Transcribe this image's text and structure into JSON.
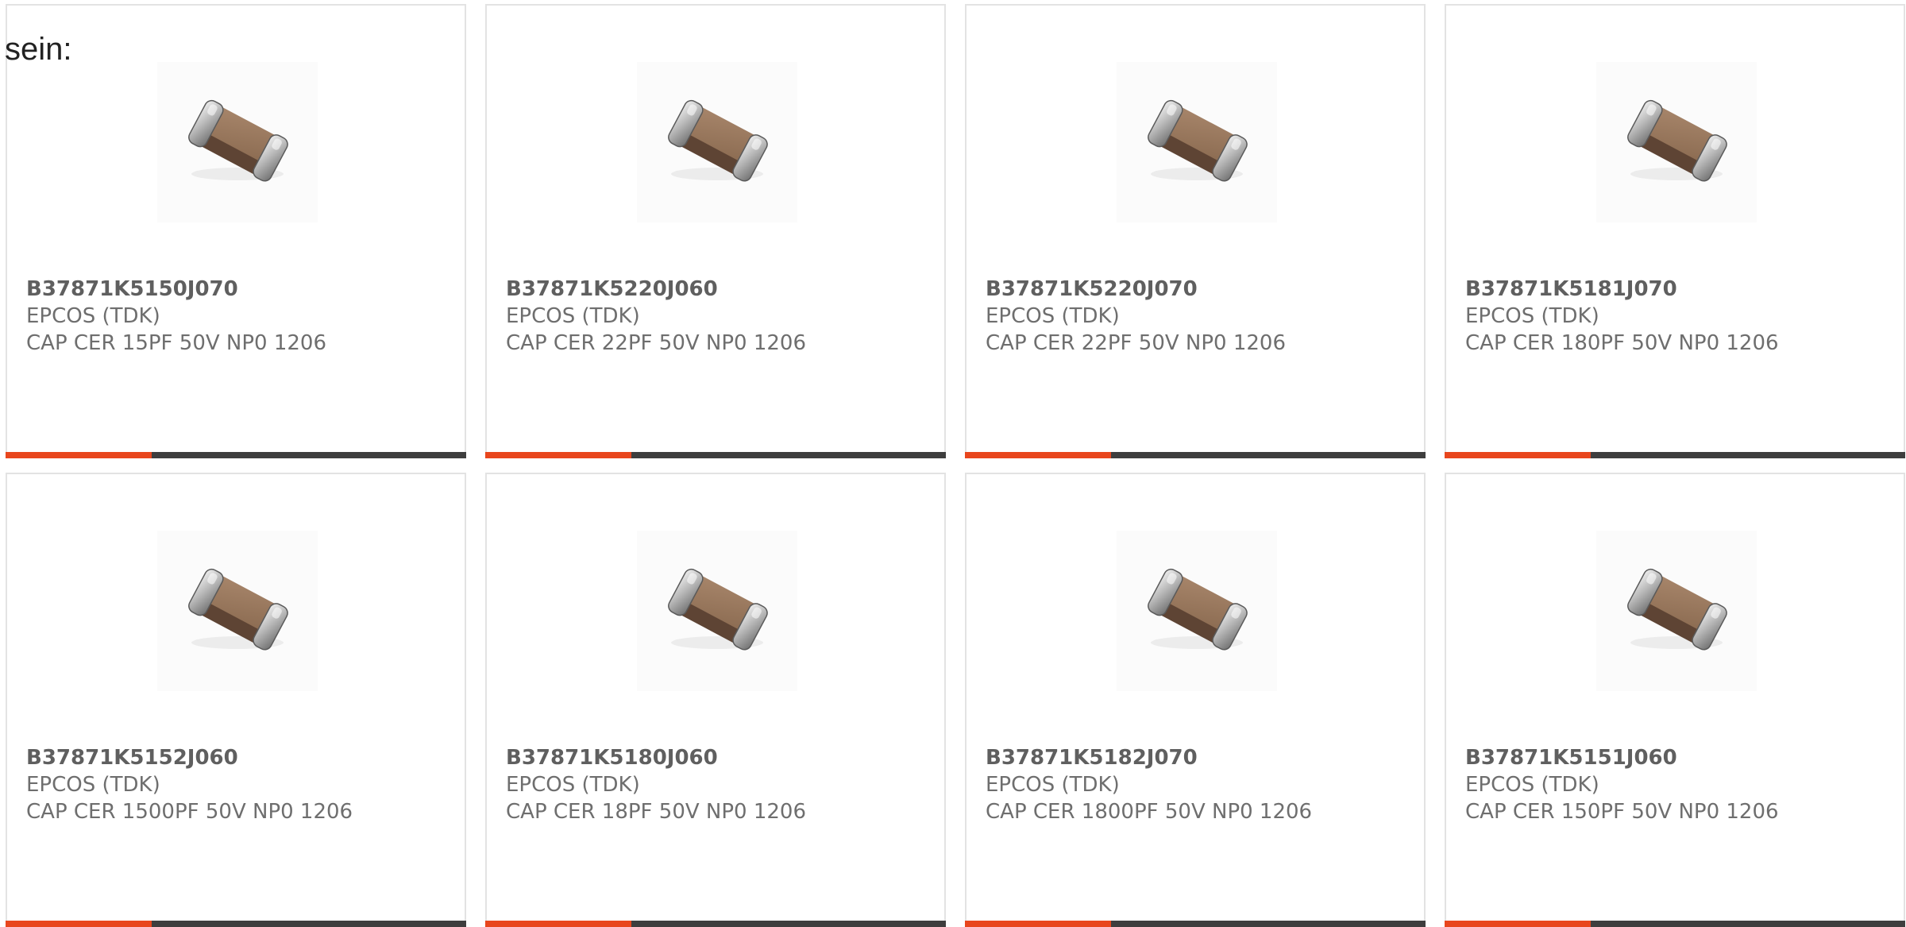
{
  "intro_text": "sein:",
  "accent_color": "#e8461d",
  "products": [
    {
      "part_number": "B37871K5150J070",
      "manufacturer": "EPCOS (TDK)",
      "description": "CAP CER 15PF 50V NP0 1206",
      "image_icon": "smd-capacitor-icon"
    },
    {
      "part_number": "B37871K5220J060",
      "manufacturer": "EPCOS (TDK)",
      "description": "CAP CER 22PF 50V NP0 1206",
      "image_icon": "smd-capacitor-icon"
    },
    {
      "part_number": "B37871K5220J070",
      "manufacturer": "EPCOS (TDK)",
      "description": "CAP CER 22PF 50V NP0 1206",
      "image_icon": "smd-capacitor-icon"
    },
    {
      "part_number": "B37871K5181J070",
      "manufacturer": "EPCOS (TDK)",
      "description": "CAP CER 180PF 50V NP0 1206",
      "image_icon": "smd-capacitor-icon"
    },
    {
      "part_number": "B37871K5152J060",
      "manufacturer": "EPCOS (TDK)",
      "description": "CAP CER 1500PF 50V NP0 1206",
      "image_icon": "smd-capacitor-icon"
    },
    {
      "part_number": "B37871K5180J060",
      "manufacturer": "EPCOS (TDK)",
      "description": "CAP CER 18PF 50V NP0 1206",
      "image_icon": "smd-capacitor-icon"
    },
    {
      "part_number": "B37871K5182J070",
      "manufacturer": "EPCOS (TDK)",
      "description": "CAP CER 1800PF 50V NP0 1206",
      "image_icon": "smd-capacitor-icon"
    },
    {
      "part_number": "B37871K5151J060",
      "manufacturer": "EPCOS (TDK)",
      "description": "CAP CER 150PF 50V NP0 1206",
      "image_icon": "smd-capacitor-icon"
    }
  ]
}
